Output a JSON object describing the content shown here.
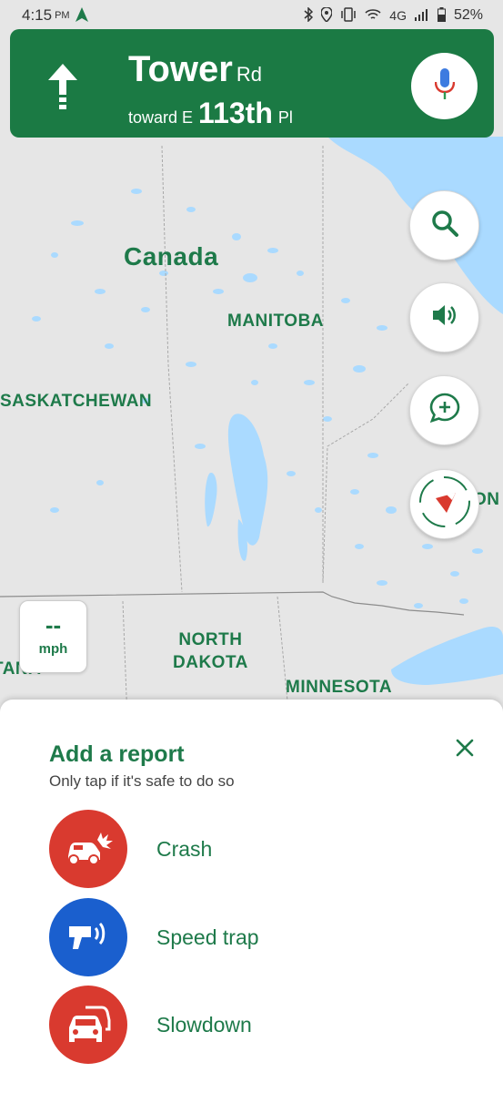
{
  "status_bar": {
    "time": "4:15",
    "ampm": "PM",
    "network": "4G",
    "battery": "52%"
  },
  "navigation": {
    "street_main": "Tower",
    "street_suffix": "Rd",
    "toward_prefix": "toward E",
    "toward_main": "113th",
    "toward_suffix": "Pl"
  },
  "map": {
    "labels": {
      "country": "Canada",
      "manitoba": "MANITOBA",
      "saskatchewan": "SASKATCHEWAN",
      "north_dakota_line1": "NORTH",
      "north_dakota_line2": "DAKOTA",
      "minnesota": "MINNESOTA",
      "ontario_partial": "ON",
      "montana_partial": "TANA"
    }
  },
  "speed": {
    "value": "--",
    "unit": "mph"
  },
  "report_sheet": {
    "title": "Add a report",
    "subtitle": "Only tap if it's safe to do so",
    "items": [
      {
        "label": "Crash",
        "color": "#d93a2f",
        "icon": "crash-icon"
      },
      {
        "label": "Speed trap",
        "color": "#1a5fce",
        "icon": "speed-trap-icon"
      },
      {
        "label": "Slowdown",
        "color": "#d93a2f",
        "icon": "slowdown-icon"
      }
    ]
  },
  "colors": {
    "nav_green": "#1b7a44",
    "label_green": "#1e7a4a",
    "water": "#aadaff",
    "land": "#e6e6e6"
  }
}
